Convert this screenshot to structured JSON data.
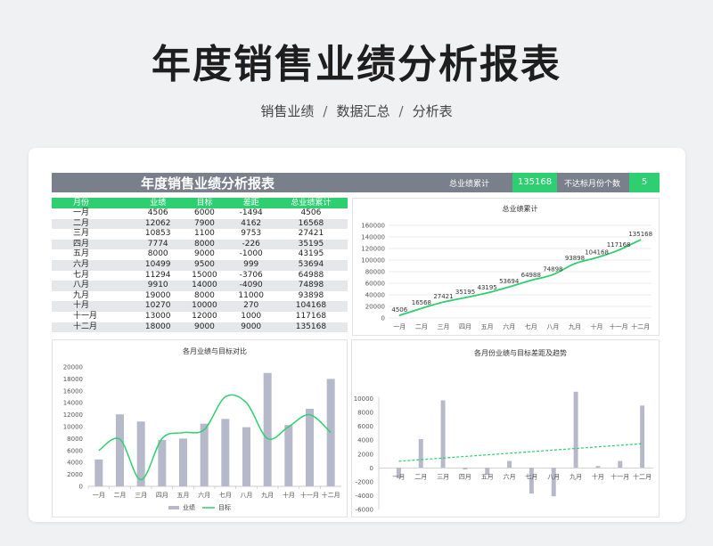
{
  "page": {
    "title": "年度销售业绩分析报表",
    "breadcrumb": [
      "销售业绩",
      "数据汇总",
      "分析表"
    ]
  },
  "header": {
    "title": "年度销售业绩分析报表",
    "total_label": "总业绩累计",
    "total_value": "135168",
    "miss_label": "不达标月份个数",
    "miss_value": "5"
  },
  "table": {
    "columns": [
      "月份",
      "业绩",
      "目标",
      "差距",
      "总业绩累计"
    ],
    "rows": [
      [
        "一月",
        "4506",
        "6000",
        "-1494",
        "4506"
      ],
      [
        "二月",
        "12062",
        "7900",
        "4162",
        "16568"
      ],
      [
        "三月",
        "10853",
        "1100",
        "9753",
        "27421"
      ],
      [
        "四月",
        "7774",
        "8000",
        "-226",
        "35195"
      ],
      [
        "五月",
        "8000",
        "9000",
        "-1000",
        "43195"
      ],
      [
        "六月",
        "10499",
        "9500",
        "999",
        "53694"
      ],
      [
        "七月",
        "11294",
        "15000",
        "-3706",
        "64988"
      ],
      [
        "八月",
        "9910",
        "14000",
        "-4090",
        "74898"
      ],
      [
        "九月",
        "19000",
        "8000",
        "11000",
        "93898"
      ],
      [
        "十月",
        "10270",
        "10000",
        "270",
        "104168"
      ],
      [
        "十一月",
        "13000",
        "12000",
        "1000",
        "117168"
      ],
      [
        "十二月",
        "18000",
        "9000",
        "9000",
        "135168"
      ]
    ]
  },
  "chart_data": [
    {
      "type": "line",
      "title": "总业绩累计",
      "categories": [
        "一月",
        "二月",
        "三月",
        "四月",
        "五月",
        "六月",
        "七月",
        "八月",
        "九月",
        "十月",
        "十一月",
        "十二月"
      ],
      "values": [
        4506,
        16568,
        27421,
        35195,
        43195,
        53694,
        64988,
        74898,
        93898,
        104168,
        117168,
        135168
      ],
      "ylim": [
        0,
        160000
      ],
      "yticks": [
        0,
        20000,
        40000,
        60000,
        80000,
        100000,
        120000,
        140000,
        160000
      ],
      "color": "#2ecf70",
      "data_labels": true,
      "grid": true
    },
    {
      "type": "bar",
      "title": "各月业绩与目标对比",
      "categories": [
        "一月",
        "二月",
        "三月",
        "四月",
        "五月",
        "六月",
        "七月",
        "八月",
        "九月",
        "十月",
        "十一月",
        "十二月"
      ],
      "series": [
        {
          "name": "业绩",
          "type": "bar",
          "color": "#b6b9c9",
          "values": [
            4506,
            12062,
            10853,
            7774,
            8000,
            10499,
            11294,
            9910,
            19000,
            10270,
            13000,
            18000
          ]
        },
        {
          "name": "目标",
          "type": "line",
          "color": "#2ecf70",
          "values": [
            6000,
            7900,
            1100,
            8000,
            9000,
            9500,
            15000,
            14000,
            8000,
            10000,
            12000,
            9000
          ]
        }
      ],
      "ylim": [
        0,
        20000
      ],
      "yticks": [
        0,
        2000,
        4000,
        6000,
        8000,
        10000,
        12000,
        14000,
        16000,
        18000,
        20000
      ],
      "legend": "bottom"
    },
    {
      "type": "bar",
      "title": "各月份业绩与目标差距及趋势",
      "categories": [
        "一月",
        "二月",
        "三月",
        "四月",
        "五月",
        "六月",
        "七月",
        "八月",
        "九月",
        "十月",
        "十一月",
        "十二月"
      ],
      "values": [
        -1494,
        4162,
        9753,
        -226,
        -1000,
        999,
        -3706,
        -4090,
        11000,
        270,
        1000,
        9000
      ],
      "trendline": {
        "start": 967,
        "end": 3500
      },
      "color": "#b6b9c9",
      "trend_color": "#2ecf70",
      "ylim": [
        -6000,
        12000
      ],
      "yticks": [
        -6000,
        -4000,
        -2000,
        0,
        2000,
        4000,
        6000,
        8000,
        10000,
        12000
      ]
    }
  ]
}
